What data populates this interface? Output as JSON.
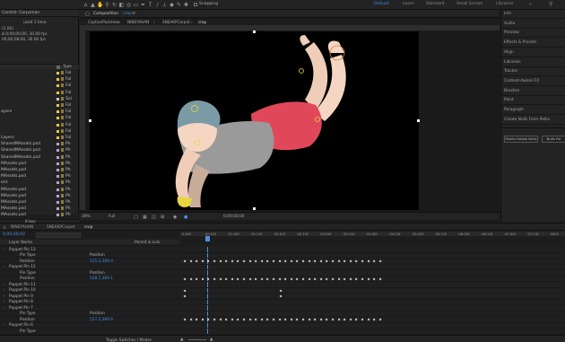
{
  "topbar": {
    "workspaces": [
      "Default",
      "Learn",
      "Standard",
      "Small Screen",
      "Libraries"
    ],
    "active_workspace": "Default",
    "snapping_label": "Snapping"
  },
  "project_panel": {
    "header": "Control: Corpsman",
    "info_lines": [
      "used 1 time",
      "(1.00)",
      "Δ 0;00;00;00, 30.00 fps",
      "00;00;08;00, 30.00 fps"
    ],
    "type_col": "Type",
    "rows": [
      {
        "name": "",
        "type": "Fol"
      },
      {
        "name": "",
        "type": "Fol"
      },
      {
        "name": "",
        "type": "Fol"
      },
      {
        "name": "",
        "type": "Fol"
      },
      {
        "name": "",
        "type": "Sol"
      },
      {
        "name": "",
        "type": "Fol"
      },
      {
        "name": "ayers",
        "type": "Fol"
      },
      {
        "name": "",
        "type": "Fol"
      },
      {
        "name": "",
        "type": "Fol"
      },
      {
        "name": "",
        "type": "Fol"
      },
      {
        "name": "Layers",
        "type": "Fol"
      },
      {
        "name": "SharedMAssets.psd",
        "type": "Ph"
      },
      {
        "name": "SharedMAssets.psd",
        "type": "Ph"
      },
      {
        "name": "SharedMAssets.psd",
        "type": "Ph"
      },
      {
        "name": "MAssets.psd",
        "type": "Ph"
      },
      {
        "name": "MAssets.psd",
        "type": "Ph"
      },
      {
        "name": "MAssets.psd",
        "type": "Ph"
      },
      {
        "name": "ent",
        "type": "Ph"
      },
      {
        "name": "MAssets.psd",
        "type": "Ph"
      },
      {
        "name": "MAssets.psd",
        "type": "Ph"
      },
      {
        "name": "MAssets.psd",
        "type": "Ph"
      },
      {
        "name": "MAssets.psd",
        "type": "Ph"
      },
      {
        "name": "MAssets.psd",
        "type": "Ph"
      }
    ],
    "bpc": "8 bpc"
  },
  "composition": {
    "panel_title": "Composition",
    "comp_name": "crop",
    "breadcrumbs": [
      "CaptionPackHero",
      "NINEYAHAN",
      "SNEAKPCarpet",
      "crop"
    ],
    "zoom": "39%",
    "resolution": "Full",
    "timecode": "0;00;00;00"
  },
  "right_panel": {
    "items": [
      "Info",
      "Audio",
      "Preview",
      "Effects & Presets",
      "Align",
      "Libraries",
      "Tracker",
      "Content-Aware Fill",
      "Brushes",
      "Paint",
      "Paragraph",
      "Create Nulls From Paths"
    ],
    "buttons": [
      "Points Follow Nulls",
      "Nulls Fol"
    ]
  },
  "timeline": {
    "tabs": [
      "NINEYAHAN",
      "SNEAKPCarpet",
      "crop"
    ],
    "active_tab": "crop",
    "current_time": "0;00;00;00",
    "search_placeholder": "",
    "parent_col": "Parent & Link",
    "layer_name_col": "Layer Name",
    "ruler": [
      "0;00f",
      "00:15f",
      "01:00f",
      "01:15f",
      "02:00f",
      "02:15f",
      "03:00f",
      "03:15f",
      "04:00f",
      "04:15f",
      "05:00f",
      "05:15f",
      "06:00f",
      "06:15f",
      "07:00f",
      "07:15f",
      "08:0"
    ],
    "rows": [
      {
        "indent": 1,
        "label": "Puppet Pin 13",
        "value": ""
      },
      {
        "indent": 2,
        "label": "Pin Type",
        "value": "Position"
      },
      {
        "indent": 2,
        "label": "Position",
        "value": "535.2,389.0"
      },
      {
        "indent": 1,
        "label": "Puppet Pin 12",
        "value": ""
      },
      {
        "indent": 2,
        "label": "Pin Type",
        "value": "Position"
      },
      {
        "indent": 2,
        "label": "Position",
        "value": "548.7,389.1"
      },
      {
        "indent": 1,
        "label": "Puppet Pin 11",
        "value": ""
      },
      {
        "indent": 1,
        "label": "Puppet Pin 10",
        "value": ""
      },
      {
        "indent": 1,
        "label": "Puppet Pin 9",
        "value": ""
      },
      {
        "indent": 1,
        "label": "Puppet Pin 8",
        "value": ""
      },
      {
        "indent": 1,
        "label": "Puppet Pin 7",
        "value": ""
      },
      {
        "indent": 2,
        "label": "Pin Type",
        "value": "Position"
      },
      {
        "indent": 2,
        "label": "Position",
        "value": "527.2,389.6"
      },
      {
        "indent": 1,
        "label": "Puppet Pin 6",
        "value": ""
      },
      {
        "indent": 2,
        "label": "Pin Type",
        "value": ""
      }
    ],
    "footer": "Toggle Switches / Modes",
    "colors": {
      "accent": "#2d8ceb",
      "playhead": "#4a90e2",
      "ruler": "#2a2a2a"
    }
  }
}
